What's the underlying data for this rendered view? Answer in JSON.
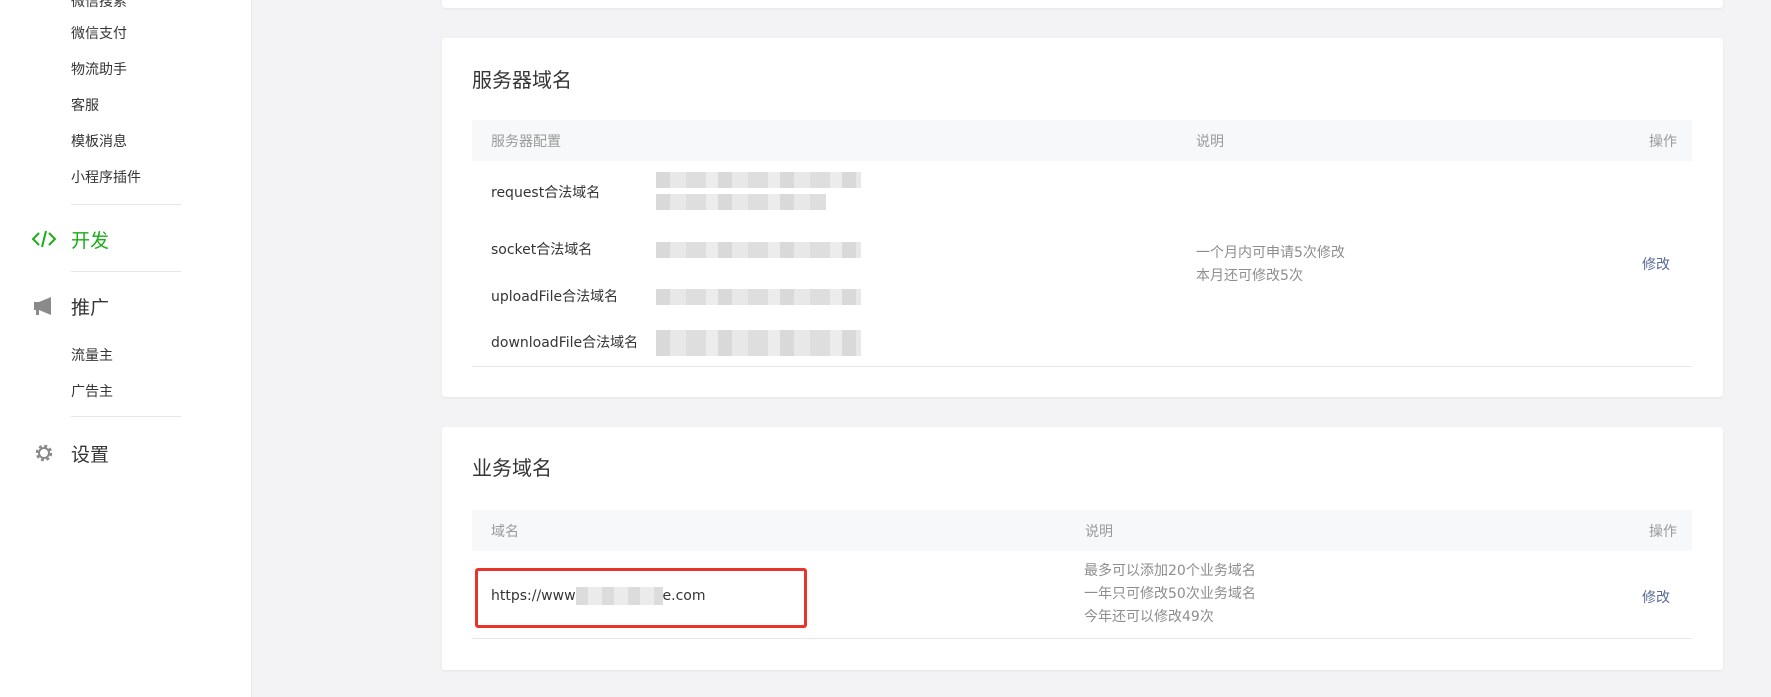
{
  "sidebar": {
    "top_items": [
      "微信搜索",
      "微信支付",
      "物流助手",
      "客服",
      "模板消息",
      "小程序插件"
    ],
    "dev_group": {
      "icon": "code-icon",
      "label": "开发"
    },
    "promo_group": {
      "icon": "megaphone-icon",
      "label": "推广",
      "items": [
        "流量主",
        "广告主"
      ]
    },
    "settings_group": {
      "icon": "gear-icon",
      "label": "设置"
    }
  },
  "server_domain": {
    "title": "服务器域名",
    "columns": [
      "服务器配置",
      "说明",
      "操作"
    ],
    "rows": [
      "request合法域名",
      "socket合法域名",
      "uploadFile合法域名",
      "downloadFile合法域名"
    ],
    "desc": [
      "一个月内可申请5次修改",
      "本月还可修改5次"
    ],
    "action": "修改"
  },
  "business_domain": {
    "title": "业务域名",
    "columns": [
      "域名",
      "说明",
      "操作"
    ],
    "domain_prefix": "https://www",
    "domain_suffix": "e.com",
    "desc": [
      "最多可以添加20个业务域名",
      "一年只可修改50次业务域名",
      "今年还可以修改49次"
    ],
    "action": "修改"
  },
  "colors": {
    "accent": "#1aad19",
    "link": "#576b95",
    "highlight": "#e8342c"
  }
}
